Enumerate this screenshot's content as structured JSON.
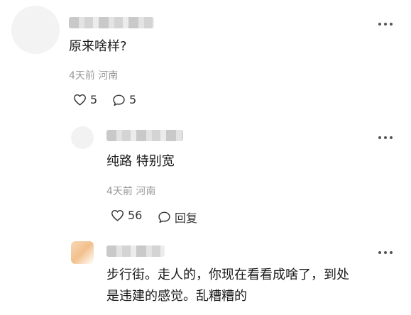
{
  "comments": [
    {
      "text": "原来啥样?",
      "time": "4天前",
      "location": "河南",
      "likes": "5",
      "replies": "5"
    },
    {
      "text": "纯路 特别宽",
      "time": "4天前",
      "location": "河南",
      "likes": "56",
      "reply_label": "回复"
    },
    {
      "text_line1": "步行街。走人的，你现在看看成啥了，到处",
      "text_line2": "是违建的感觉。乱糟糟的"
    }
  ],
  "icons": {
    "like": "heart-outline-icon",
    "reply": "speech-bubble-icon",
    "more": "more-dots-icon"
  }
}
